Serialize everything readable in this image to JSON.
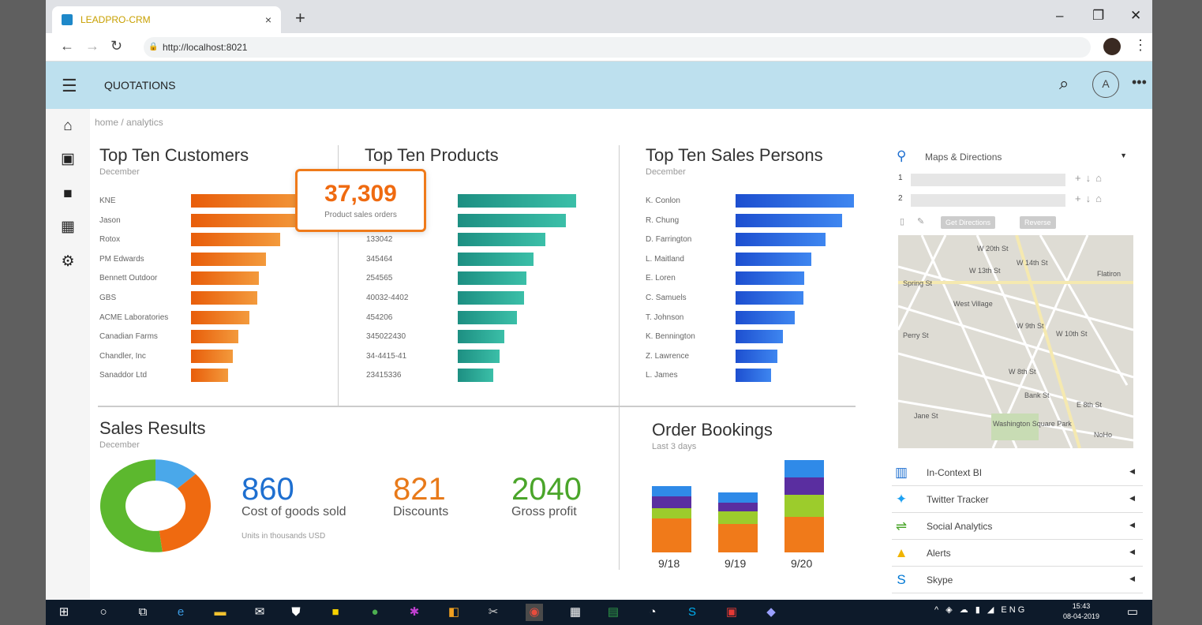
{
  "browser": {
    "tab_title": "LEADPRO-CRM",
    "tab_close": "×",
    "new_tab": "+",
    "url": "http://localhost:8021",
    "win": [
      "–",
      "❐",
      "✕"
    ]
  },
  "header": {
    "title": "QUOTATIONS",
    "avatar": "A"
  },
  "breadcrumb": "home / analytics",
  "customers": {
    "title": "Top Ten Customers",
    "subtitle": "December",
    "items": [
      {
        "label": "KNE",
        "value": 100
      },
      {
        "label": "Jason",
        "value": 96
      },
      {
        "label": "Rotox",
        "value": 75
      },
      {
        "label": "PM Edwards",
        "value": 63
      },
      {
        "label": "Bennett Outdoor",
        "value": 57
      },
      {
        "label": "GBS",
        "value": 56
      },
      {
        "label": "ACME Laboratories",
        "value": 49
      },
      {
        "label": "Canadian Farms",
        "value": 40
      },
      {
        "label": "Chandler, Inc",
        "value": 35
      },
      {
        "label": "Sanaddor Ltd",
        "value": 31
      }
    ]
  },
  "callout": {
    "value": "37,309",
    "label": "Product sales orders"
  },
  "products": {
    "title": "Top Ten Products",
    "items": [
      {
        "label": "",
        "value": 100
      },
      {
        "label": "",
        "value": 91
      },
      {
        "label": "133042",
        "value": 74
      },
      {
        "label": "345464",
        "value": 64
      },
      {
        "label": "254565",
        "value": 58
      },
      {
        "label": "40032-4402",
        "value": 56
      },
      {
        "label": "454206",
        "value": 50
      },
      {
        "label": "345022430",
        "value": 39
      },
      {
        "label": "34-4415-41",
        "value": 35
      },
      {
        "label": "23415336",
        "value": 30
      }
    ]
  },
  "salespersons": {
    "title": "Top Ten Sales Persons",
    "subtitle": "December",
    "items": [
      {
        "label": "K. Conlon",
        "value": 100
      },
      {
        "label": "R. Chung",
        "value": 90
      },
      {
        "label": "D. Farrington",
        "value": 76
      },
      {
        "label": "L. Maitland",
        "value": 64
      },
      {
        "label": "E. Loren",
        "value": 58
      },
      {
        "label": "C. Samuels",
        "value": 57
      },
      {
        "label": "T. Johnson",
        "value": 50
      },
      {
        "label": "K. Bennington",
        "value": 40
      },
      {
        "label": "Z. Lawrence",
        "value": 35
      },
      {
        "label": "L. James",
        "value": 30
      }
    ]
  },
  "sales": {
    "title": "Sales Results",
    "subtitle": "December",
    "kpis": [
      {
        "value": "860",
        "label": "Cost of goods sold",
        "color": "#1e6fd0"
      },
      {
        "value": "821",
        "label": "Discounts",
        "color": "#e87a1a"
      },
      {
        "value": "2040",
        "label": "Gross profit",
        "color": "#4aa52a"
      }
    ],
    "units": "Units in thousands USD",
    "donut": [
      {
        "value": 0.13,
        "color": "#4aa8ea"
      },
      {
        "value": 0.35,
        "color": "#ef6a10"
      },
      {
        "value": 0.52,
        "color": "#5cb82e"
      }
    ]
  },
  "bookings": {
    "title": "Order Bookings",
    "subtitle": "Last 3 days",
    "series": [
      {
        "name": "orange",
        "color": "#f07a1a"
      },
      {
        "name": "lime",
        "color": "#9ccc2c"
      },
      {
        "name": "purple",
        "color": "#5a2ea0"
      },
      {
        "name": "blue",
        "color": "#2f8ae8"
      }
    ],
    "days": [
      {
        "label": "9/18",
        "values": [
          40,
          12,
          14,
          12
        ]
      },
      {
        "label": "9/19",
        "values": [
          33,
          15,
          10,
          12
        ]
      },
      {
        "label": "9/20",
        "values": [
          42,
          26,
          20,
          20
        ]
      }
    ]
  },
  "maps": {
    "title": "Maps & Directions",
    "row1_label": "1",
    "row2_label": "2",
    "get_directions": "Get Directions",
    "reverse": "Reverse",
    "places": [
      "W 20th St",
      "W 14th St",
      "W 13th St",
      "W 10th St",
      "W 9th St",
      "W 8th St",
      "E 8th St",
      "Flatiron",
      "West Village",
      "Washington Square Park",
      "NoHo",
      "Perry St",
      "Jane St",
      "Bank St",
      "Spring St"
    ]
  },
  "widgets": [
    {
      "icon": "chart-icon",
      "label": "In-Context BI",
      "color": "#1e6fd0",
      "glyph": "▥"
    },
    {
      "icon": "twitter-icon",
      "label": "Twitter Tracker",
      "color": "#1da1f2",
      "glyph": "✦"
    },
    {
      "icon": "social-icon",
      "label": "Social Analytics",
      "color": "#4aa52a",
      "glyph": "⇌"
    },
    {
      "icon": "alerts-icon",
      "label": "Alerts",
      "color": "#f0b400",
      "glyph": "▲"
    },
    {
      "icon": "skype-icon",
      "label": "Skype",
      "color": "#0078d4",
      "glyph": "S"
    }
  ],
  "taskbar": {
    "lang": "ENG",
    "time": "15:43",
    "date": "08-04-2019"
  }
}
